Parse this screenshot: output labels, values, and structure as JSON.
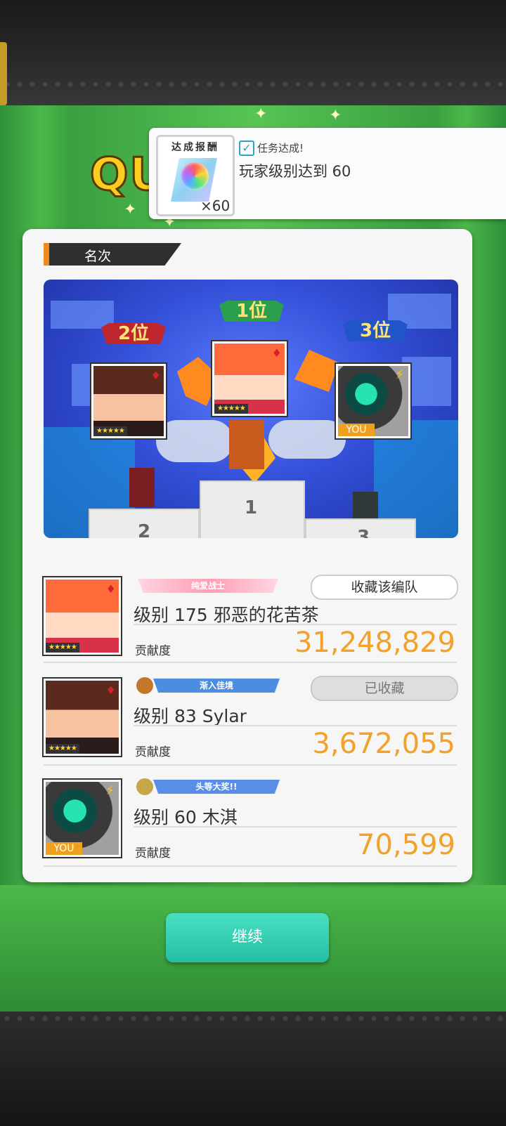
{
  "screen_title_partial": "QU",
  "reward_toast": {
    "header": "达成报酬",
    "item_icon": "rainbow-orb-icon",
    "quantity": "×60",
    "status": "任务达成!",
    "description": "玩家级别达到 60"
  },
  "ranking_card": {
    "section_label": "名次",
    "podium": {
      "first_label": "1位",
      "second_label": "2位",
      "third_label": "3位",
      "block_1": "1",
      "block_2": "2",
      "block_3": "3",
      "you_tag": "YOU",
      "stars": "★★★★★"
    },
    "rows": [
      {
        "title_badge": "纯爱战士",
        "save_button": "收藏该编队",
        "name": "级别 175 邪恶的花苦茶",
        "label": "贡献度",
        "score": "31,248,829",
        "stars": "★★★★★"
      },
      {
        "title_badge": "渐入佳境",
        "save_button": "已收藏",
        "name": "级别 83 Sylar",
        "label": "贡献度",
        "score": "3,672,055",
        "stars": "★★★★★"
      },
      {
        "title_badge": "头等大奖!!",
        "name": "级别 60 木淇",
        "label": "贡献度",
        "score": "70,599",
        "you_tag": "YOU"
      }
    ]
  },
  "continue_button": "继续",
  "colors": {
    "score_orange": "#f2a12a",
    "continue_teal": "#25bfa6",
    "tag_accent": "#f08a1c"
  }
}
